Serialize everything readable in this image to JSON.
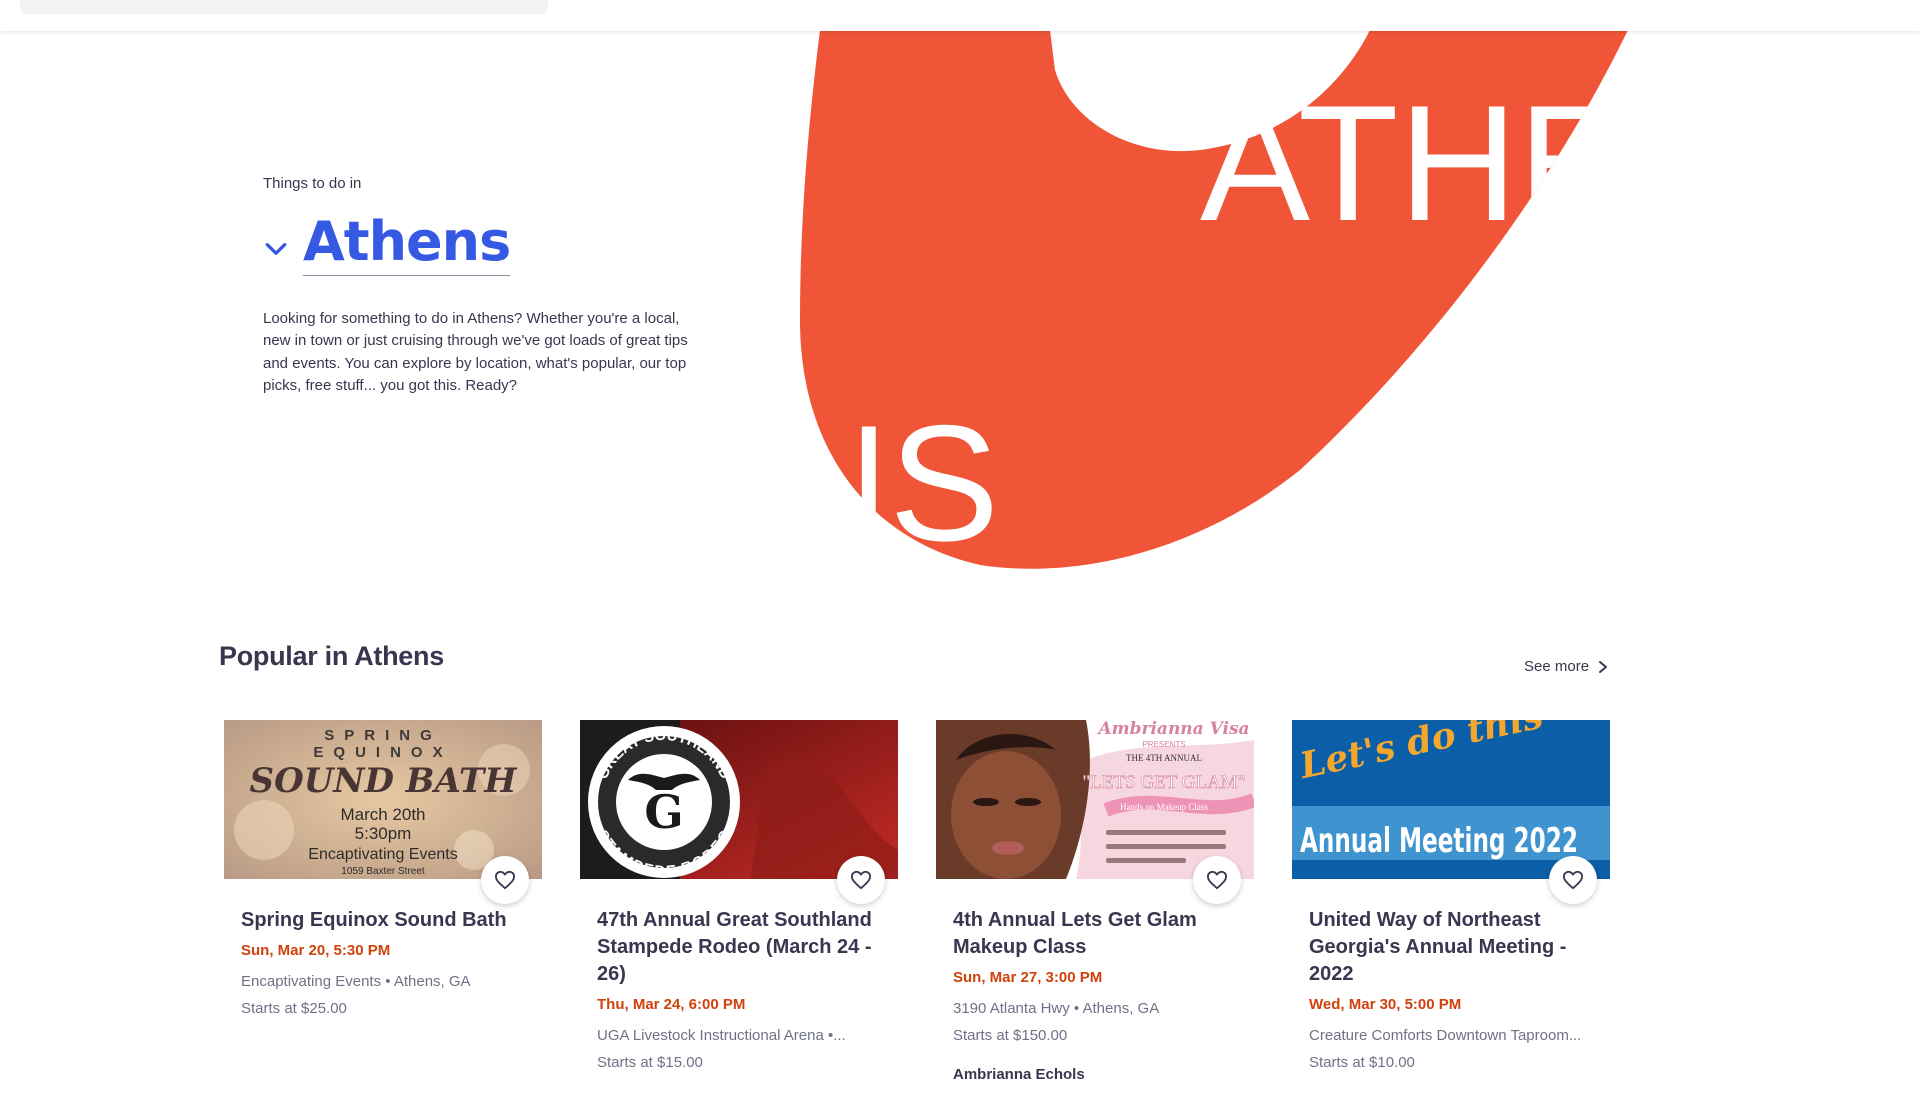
{
  "hero": {
    "eyebrow": "Things to do in",
    "city": "Athens",
    "intro": "Looking for something to do in Athens? Whether you're a local, new in town or just cruising through we've got loads of great tips and events. You can explore by location, what's popular, our top picks, free stuff... you got this. Ready?",
    "art_text_top": "ATHE",
    "art_text_bottom": "NS",
    "art_color": "#f05537"
  },
  "popular": {
    "title": "Popular in Athens",
    "see_more": "See more"
  },
  "events": [
    {
      "title": "Spring Equinox Sound Bath",
      "date": "Sun, Mar 20, 5:30 PM",
      "venue": "Encaptivating Events • Athens, GA",
      "price": "Starts at $25.00",
      "organizer": "",
      "image": {
        "line1": "SPRING",
        "line2": "EQUINOX",
        "headline": "SOUND BATH",
        "date": "March 20th",
        "time": "5:30pm",
        "host": "Encaptivating Events",
        "address": "1059 Baxter Street"
      }
    },
    {
      "title": "47th Annual Great Southland Stampede Rodeo (March 24 - 26)",
      "date": "Thu, Mar 24, 6:00 PM",
      "venue": "UGA Livestock Instructional Arena •...",
      "price": "Starts at $15.00",
      "organizer": "",
      "image": {
        "ring_top": "GREAT SOUTHLAND",
        "ring_bottom": "STAMPEDE RODEO",
        "letter": "G"
      }
    },
    {
      "title": "4th Annual Lets Get Glam Makeup Class",
      "date": "Sun, Mar 27, 3:00 PM",
      "venue": "3190 Atlanta Hwy • Athens, GA",
      "price": "Starts at $150.00",
      "organizer": "Ambrianna Echols",
      "image": {
        "brand": "Ambrianna Visa",
        "presents": "PRESENTS",
        "edition": "THE 4TH ANNUAL",
        "headline": "\"LETS GET GLAM\"",
        "subhead": "Hands on Makeup Class"
      }
    },
    {
      "title": "United Way of Northeast Georgia's Annual Meeting - 2022",
      "date": "Wed, Mar 30, 5:00 PM",
      "venue": "Creature Comforts Downtown Taproom...",
      "price": "Starts at $10.00",
      "organizer": "",
      "image": {
        "script": "Let's do this",
        "banner": "Annual Meeting 2022"
      }
    }
  ],
  "icons": {
    "chevron": "chevron-down-icon",
    "favorite": "heart-outline-icon",
    "see_more_arrow": "chevron-right-icon"
  },
  "colors": {
    "accent_blue": "#3659e3",
    "date_orange": "#d1410c",
    "text_dark": "#39364f",
    "text_muted": "#6f7287"
  }
}
